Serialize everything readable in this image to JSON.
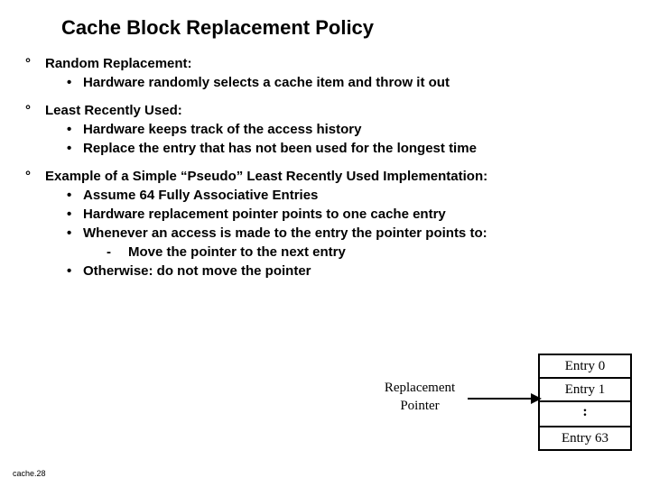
{
  "title": "Cache Block Replacement Policy",
  "bullets": {
    "b1": {
      "head": "Random Replacement:",
      "s1": "Hardware randomly selects a cache item and throw it out"
    },
    "b2": {
      "head": "Least Recently Used:",
      "s1": "Hardware keeps track of the access  history",
      "s2": "Replace the entry that has not been used for the longest time"
    },
    "b3": {
      "head": "Example of a Simple “Pseudo” Least Recently Used Implementation:",
      "s1": "Assume 64 Fully Associative Entries",
      "s2": "Hardware  replacement pointer points to one cache entry",
      "s3": "Whenever an access is made to the entry the pointer points to:",
      "s3a": "Move the pointer to the next entry",
      "s4": "Otherwise: do not move the pointer"
    }
  },
  "diagram": {
    "pointer_label_line1": "Replacement",
    "pointer_label_line2": "Pointer",
    "entry0": "Entry 0",
    "entry1": "Entry 1",
    "colon": ":",
    "entry63": "Entry  63"
  },
  "footer": "cache.28"
}
